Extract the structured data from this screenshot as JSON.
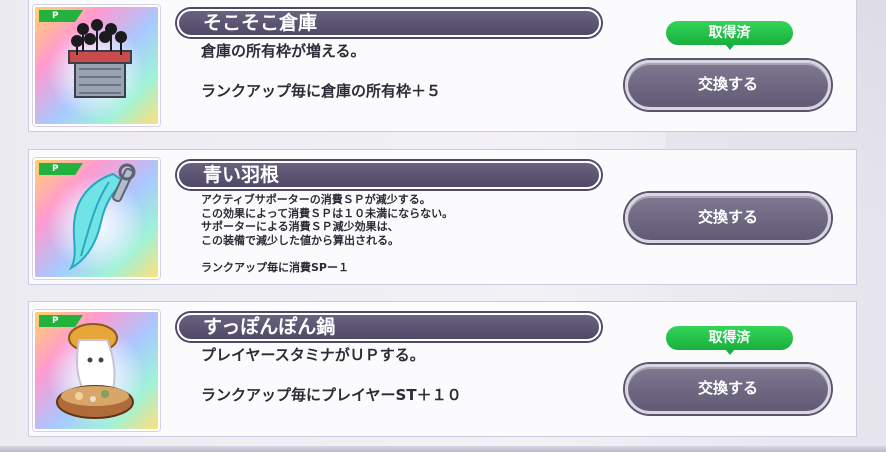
{
  "items": [
    {
      "badge": "P",
      "name": "そこそこ倉庫",
      "icon": "warehouse-with-crowd-icon",
      "description": [
        "倉庫の所有枠が増える。",
        "",
        "ランクアップ毎に倉庫の所有枠＋５"
      ],
      "status": "取得済",
      "button": "交換する"
    },
    {
      "badge": "P",
      "name": "青い羽根",
      "icon": "blue-feather-key-icon",
      "description": [
        "アクティブサポーターの消費ＳＰが減少する。",
        "この効果によって消費ＳＰは１０未満にならない。",
        "サポーターによる消費ＳＰ減少効果は、",
        "この装備で減少した値から算出される。",
        "",
        "ランクアップ毎に消費SPー１"
      ],
      "status": "",
      "button": "交換する"
    },
    {
      "badge": "P",
      "name": "すっぽんぽん鍋",
      "icon": "ghost-hotpot-icon",
      "description": [
        "プレイヤースタミナがＵＰする。",
        "",
        "ランクアップ毎にプレイヤーST＋１０"
      ],
      "status": "取得済",
      "button": "交換する"
    }
  ],
  "colors": {
    "title_bar": "#5a5370",
    "status_green": "#1fbd45",
    "button_bg": "#6e6884",
    "badge_green": "#22b23d"
  }
}
